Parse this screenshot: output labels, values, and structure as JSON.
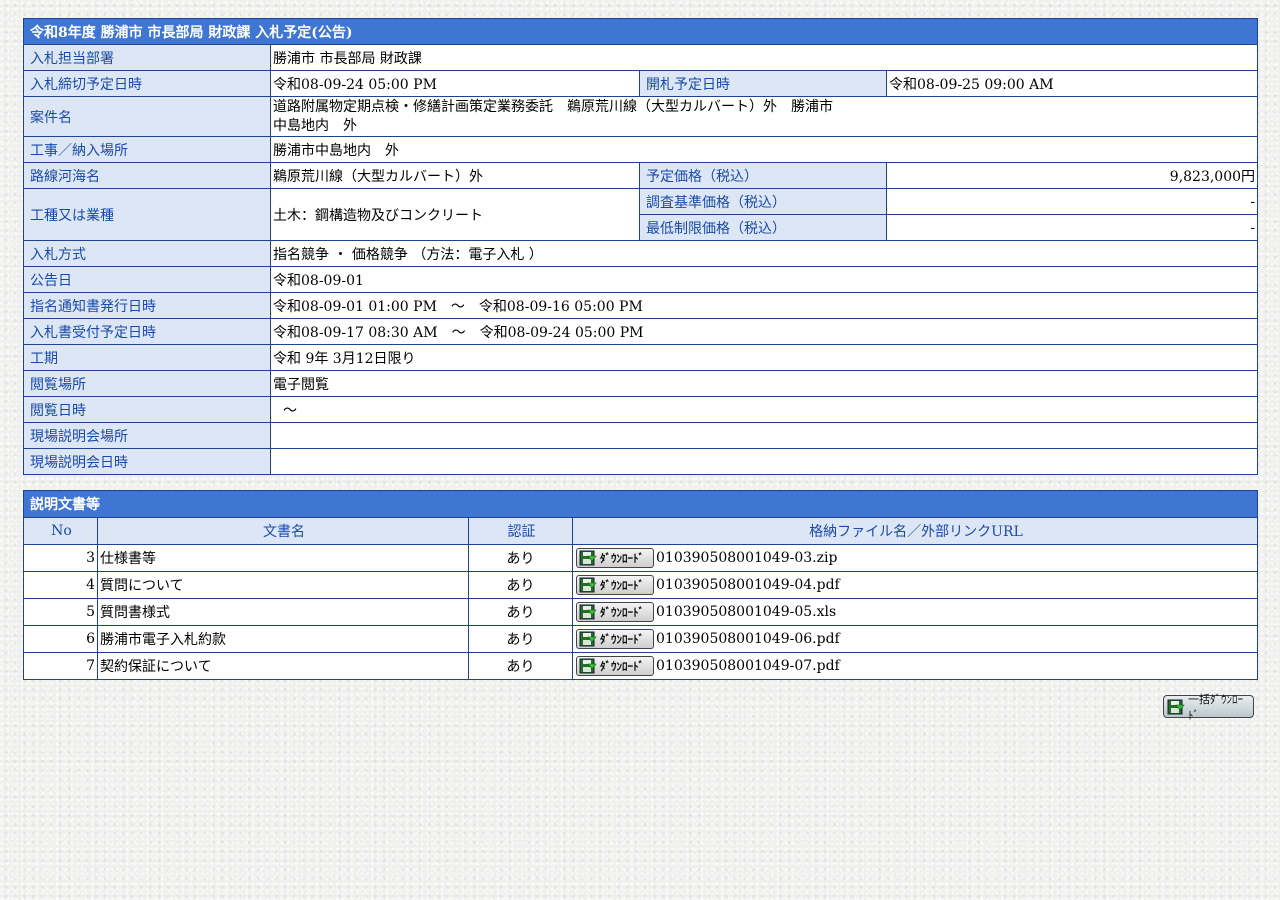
{
  "info": {
    "title": "令和8年度 勝浦市 市長部局 財政課 入札予定(公告)",
    "dept_label": "入札担当部署",
    "dept": "勝浦市 市長部局 財政課",
    "deadline_label": "入札締切予定日時",
    "deadline": "令和08-09-24 05:00 PM",
    "opening_label": "開札予定日時",
    "opening": "令和08-09-25 09:00 AM",
    "case_label": "案件名",
    "case_line1": "道路附属物定期点検・修繕計画策定業務委託　鵜原荒川線（大型カルバート）外　勝浦市",
    "case_line2": "中島地内　外",
    "place_label": "工事／納入場所",
    "place": "勝浦市中島地内　外",
    "route_label": "路線河海名",
    "route": "鵜原荒川線（大型カルバート）外",
    "price_label": "予定価格（税込）",
    "price": "9,823,000円",
    "type_label": "工種又は業種",
    "type": "土木：鋼構造物及びコンクリート",
    "survey_label": "調査基準価格（税込）",
    "survey": "-",
    "min_label": "最低制限価格（税込）",
    "min": "-",
    "method_label": "入札方式",
    "method": "指名競争 ・ 価格競争 （方法：電子入札 ）",
    "notice_label": "公告日",
    "notice": "令和08-09-01",
    "designation_label": "指名通知書発行日時",
    "designation": "令和08-09-01 01:00 PM　～　令和08-09-16 05:00 PM",
    "receipt_label": "入札書受付予定日時",
    "receipt": "令和08-09-17 08:30 AM　～　令和08-09-24 05:00 PM",
    "period_label": "工期",
    "period": "令和 9年 3月12日限り",
    "view_place_label": "閲覧場所",
    "view_place": "電子閲覧",
    "view_date_label": "閲覧日時",
    "view_date": "～",
    "site_place_label": "現場説明会場所",
    "site_place": "",
    "site_date_label": "現場説明会日時",
    "site_date": ""
  },
  "docs": {
    "title": "説明文書等",
    "headers": [
      "No",
      "文書名",
      "認証",
      "格納ファイル名／外部リンクURL"
    ],
    "download_label": "ﾀﾞｳﾝﾛｰﾄﾞ",
    "rows": [
      {
        "no": "3",
        "name": "仕様書等",
        "auth": "あり",
        "file": "010390508001049-03.zip"
      },
      {
        "no": "4",
        "name": "質問について",
        "auth": "あり",
        "file": "010390508001049-04.pdf"
      },
      {
        "no": "5",
        "name": "質問書様式",
        "auth": "あり",
        "file": "010390508001049-05.xls"
      },
      {
        "no": "6",
        "name": "勝浦市電子入札約款",
        "auth": "あり",
        "file": "010390508001049-06.pdf"
      },
      {
        "no": "7",
        "name": "契約保証について",
        "auth": "あり",
        "file": "010390508001049-07.pdf"
      }
    ]
  },
  "bulk_download_label": "一括ﾀﾞｳﾝﾛｰﾄﾞ",
  "colors": {
    "header_bg": "#3f76d3",
    "label_bg": "#dce6f5",
    "label_text": "#1a4ba8",
    "border": "#1d4391"
  }
}
